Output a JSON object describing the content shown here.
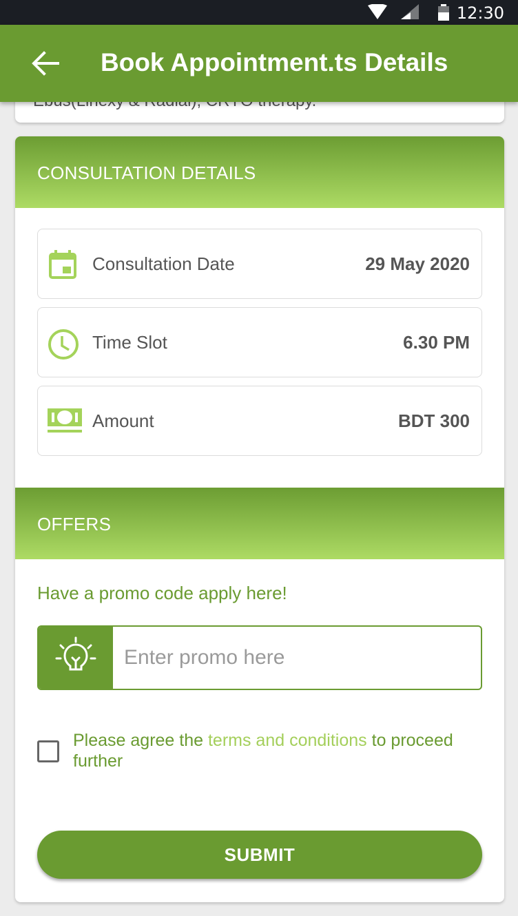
{
  "status_bar": {
    "time": "12:30"
  },
  "app_bar": {
    "title": "Book Appointment.ts Details",
    "back_icon": "arrow-left-icon"
  },
  "previous_card": {
    "clipped_text": "Ebus(Linexy & Radial), CRYO therapy."
  },
  "consultation": {
    "header": "CONSULTATION DETAILS",
    "rows": [
      {
        "icon": "calendar-icon",
        "label": "Consultation Date",
        "value": "29 May 2020"
      },
      {
        "icon": "clock-icon",
        "label": "Time Slot",
        "value": "6.30 PM"
      },
      {
        "icon": "cash-icon",
        "label": "Amount",
        "value": "BDT 300"
      }
    ]
  },
  "offers": {
    "header": "OFFERS",
    "promo_hint": "Have a promo code apply here!",
    "promo_placeholder": "Enter promo here",
    "promo_value": "",
    "promo_icon": "lightbulb-icon"
  },
  "agreement": {
    "checked": false,
    "text_before": "Please agree the ",
    "link_text": "terms and conditions",
    "text_after": " to proceed further"
  },
  "submit_label": "SUBMIT",
  "colors": {
    "primary": "#6a9b31",
    "accent_light": "#addb64",
    "link": "#a4cf5b"
  }
}
